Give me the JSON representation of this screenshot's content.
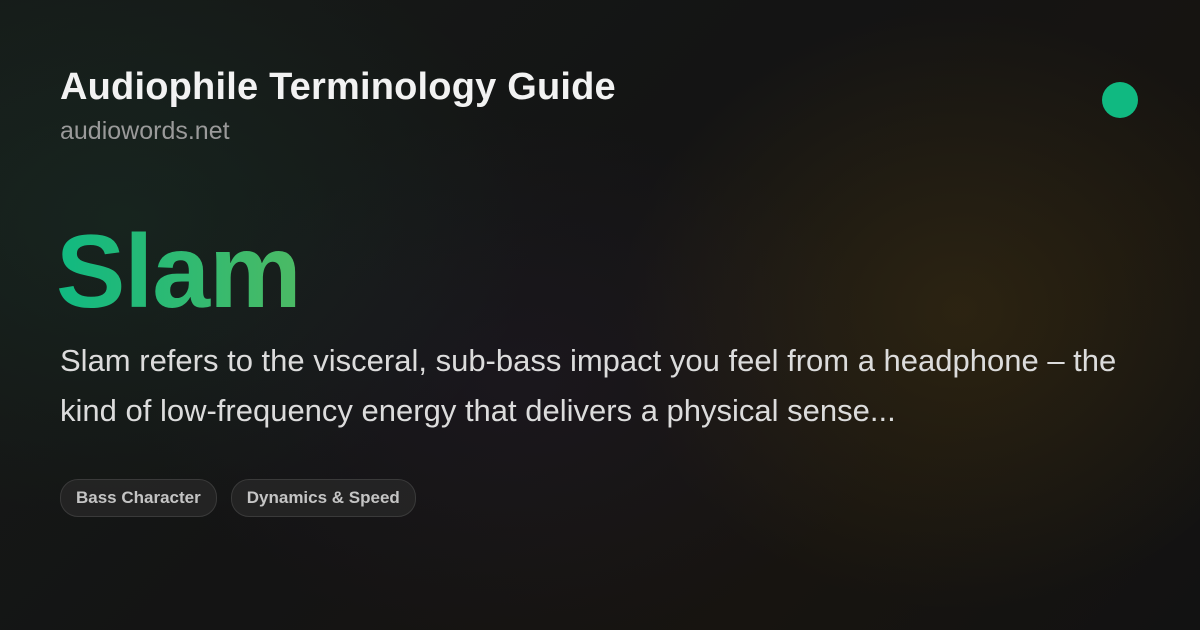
{
  "header": {
    "site_title": "Audiophile Terminology Guide",
    "site_domain": "audiowords.net",
    "status_dot_color": "#10b981"
  },
  "main": {
    "term": "Slam",
    "term_gradient": [
      "#10b981",
      "#4cba64"
    ],
    "description": "Slam refers to the visceral, sub-bass impact you feel from a headphone – the kind of low-frequency energy that delivers a physical sense..."
  },
  "tags": [
    {
      "label": "Bass Character"
    },
    {
      "label": "Dynamics & Speed"
    }
  ]
}
